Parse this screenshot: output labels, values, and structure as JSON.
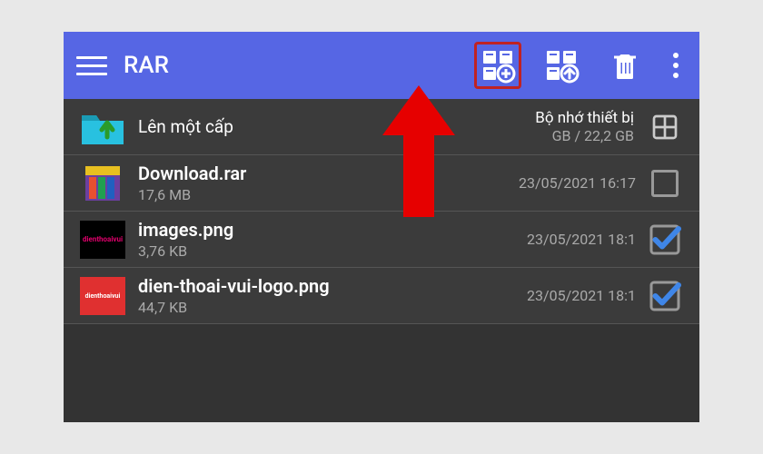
{
  "app": {
    "title": "RAR"
  },
  "toolbar": {
    "add_archive": "add-to-archive",
    "extract": "extract",
    "delete": "delete",
    "menu": "menu"
  },
  "storage": {
    "label": "Bộ nhớ thiết bị",
    "used_total": "GB / 22,2 GB"
  },
  "up": {
    "label": "Lên một cấp"
  },
  "files": [
    {
      "name": "Download.rar",
      "size": "17,6 MB",
      "date": "23/05/2021 16:17",
      "checked": false,
      "icon": "rar"
    },
    {
      "name": "images.png",
      "size": "3,76 KB",
      "date": "23/05/2021 18:1",
      "checked": true,
      "icon": "black"
    },
    {
      "name": "dien-thoai-vui-logo.png",
      "size": "44,7 KB",
      "date": "23/05/2021 18:1",
      "checked": true,
      "icon": "red"
    }
  ],
  "thumb_text": "dienthoaivui",
  "colors": {
    "primary": "#5666e4",
    "accent_check": "#3f86e8",
    "highlight": "#c02222"
  }
}
